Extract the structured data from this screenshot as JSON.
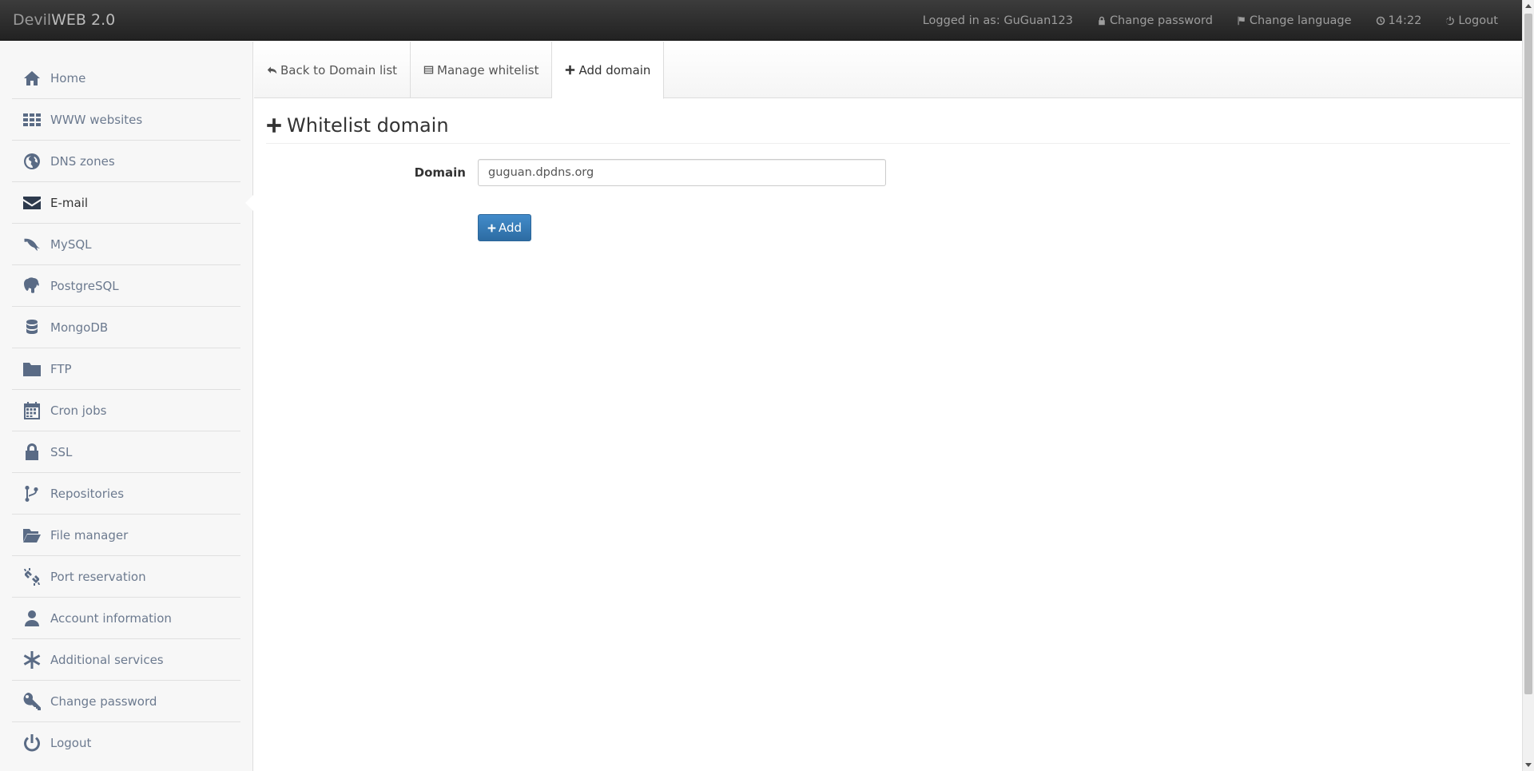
{
  "brand": {
    "prefix": "Devil",
    "suffix": "WEB 2.0"
  },
  "topnav": {
    "logged_in": "Logged in as: GuGuan123",
    "change_password": "Change password",
    "change_language": "Change language",
    "time": "14:22",
    "logout": "Logout",
    "icons": [
      "lock-icon",
      "flag-icon",
      "clock-icon",
      "power-icon"
    ]
  },
  "sidebar": {
    "items": [
      {
        "label": "Home",
        "icon": "home-icon"
      },
      {
        "label": "WWW websites",
        "icon": "grid-icon"
      },
      {
        "label": "DNS zones",
        "icon": "globe-icon"
      },
      {
        "label": "E-mail",
        "icon": "envelope-icon",
        "active": true
      },
      {
        "label": "MySQL",
        "icon": "dolphin-icon"
      },
      {
        "label": "PostgreSQL",
        "icon": "elephant-icon"
      },
      {
        "label": "MongoDB",
        "icon": "database-icon"
      },
      {
        "label": "FTP",
        "icon": "folder-icon"
      },
      {
        "label": "Cron jobs",
        "icon": "calendar-icon"
      },
      {
        "label": "SSL",
        "icon": "lock-icon"
      },
      {
        "label": "Repositories",
        "icon": "git-branch-icon"
      },
      {
        "label": "File manager",
        "icon": "folder-open-icon"
      },
      {
        "label": "Port reservation",
        "icon": "broken-link-icon"
      },
      {
        "label": "Account information",
        "icon": "user-icon"
      },
      {
        "label": "Additional services",
        "icon": "asterisk-icon"
      },
      {
        "label": "Change password",
        "icon": "key-icon"
      },
      {
        "label": "Logout",
        "icon": "power-icon"
      }
    ]
  },
  "tabs": [
    {
      "label": "Back to Domain list",
      "icon": "back-arrow-icon"
    },
    {
      "label": "Manage whitelist",
      "icon": "list-icon"
    },
    {
      "label": "Add domain",
      "icon": "plus-icon",
      "active": true
    }
  ],
  "page": {
    "title": "Whitelist domain",
    "form": {
      "domain_label": "Domain",
      "domain_value": "guguan.dpdns.org",
      "add_button": "Add"
    }
  },
  "colors": {
    "topbar": "#2b2b2b",
    "sidebar_bg": "#f7f7f7",
    "primary_button": "#337ab7",
    "icon_muted": "#5a6b85"
  }
}
